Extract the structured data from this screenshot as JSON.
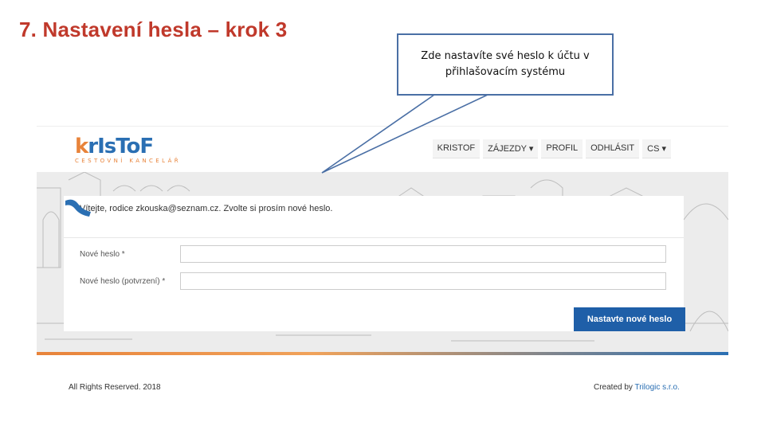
{
  "slide": {
    "title": "7. Nastavení hesla – krok 3",
    "callout_text": "Zde nastavíte své heslo k účtu v přihlašovacím systému"
  },
  "site": {
    "logo_main": "krIsToF",
    "logo_k": "k",
    "logo_rest": "rIsToF",
    "logo_sub": "CESTOVNÍ KANCELÁŘ",
    "nav": [
      "KRISTOF",
      "ZÁJEZDY ▾",
      "PROFIL",
      "ODHLÁSIT",
      "CS ▾"
    ]
  },
  "form": {
    "welcome": "Vítejte, rodice zkouska@seznam.cz. Zvolte si prosím nové heslo.",
    "new_password_label": "Nové heslo *",
    "new_password_value": "",
    "confirm_password_label": "Nové heslo (potvrzení) *",
    "confirm_password_value": "",
    "submit_label": "Nastavte nové heslo"
  },
  "footer": {
    "rights": "All Rights Reserved. 2018",
    "created_prefix": "Created by ",
    "created_brand": "Trilogic s.r.o."
  },
  "colors": {
    "title_red": "#c0392b",
    "brand_blue": "#2a6fb3",
    "brand_orange": "#e8833a",
    "button_blue": "#1f5fa8",
    "callout_border": "#4a6fa5"
  }
}
